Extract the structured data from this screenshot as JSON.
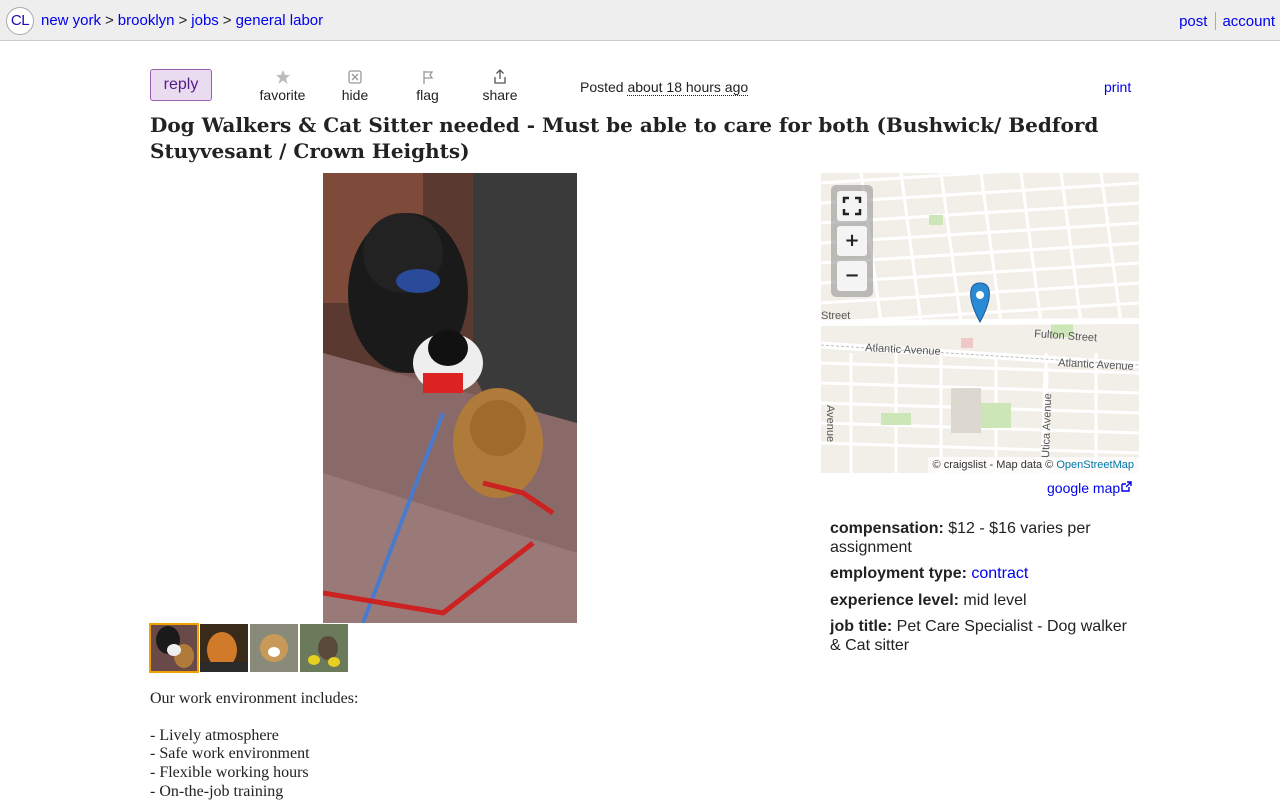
{
  "logo": "CL",
  "breadcrumb": [
    {
      "label": "new york"
    },
    {
      "label": "brooklyn"
    },
    {
      "label": "jobs"
    },
    {
      "label": "general labor"
    }
  ],
  "breadcrumb_sep": ">",
  "user_links": {
    "post": "post",
    "account": "account"
  },
  "actions": {
    "reply": "reply",
    "favorite": "favorite",
    "hide": "hide",
    "flag": "flag",
    "share": "share",
    "print": "print"
  },
  "posted": {
    "prefix": "Posted",
    "time": "about 18 hours ago"
  },
  "title": "Dog Walkers & Cat Sitter needed - Must be able to care for both (Bushwick/ Bedford Stuyvesant / Crown Heights)",
  "map": {
    "labels": {
      "street": "Street",
      "fulton": "Fulton Street",
      "atlantic_left": "Atlantic Avenue",
      "atlantic_right": "Atlantic Avenue",
      "utica": "Utica Avenue",
      "left_vertical": "Avenue"
    },
    "attribution_prefix": "© craigslist - Map data ©",
    "attribution_link": "OpenStreetMap",
    "google_map": "google map"
  },
  "attributes": [
    {
      "label": "compensation:",
      "value": "$12 - $16 varies per assignment",
      "link": false
    },
    {
      "label": "employment type:",
      "value": "contract",
      "link": true
    },
    {
      "label": "experience level:",
      "value": "mid level",
      "link": false
    },
    {
      "label": "job title:",
      "value": "Pet Care Specialist - Dog walker & Cat sitter",
      "link": false
    }
  ],
  "body": {
    "intro": "Our work environment includes:",
    "items": [
      "- Lively atmosphere",
      "- Safe work environment",
      "- Flexible working hours",
      "- On-the-job training"
    ]
  },
  "colors": {
    "link": "#0000ee",
    "reply_bg": "#eadcf0",
    "reply_border": "#9a5fb0",
    "thumb_selected": "#f0a000",
    "map_pin": "#2a8ad4"
  }
}
